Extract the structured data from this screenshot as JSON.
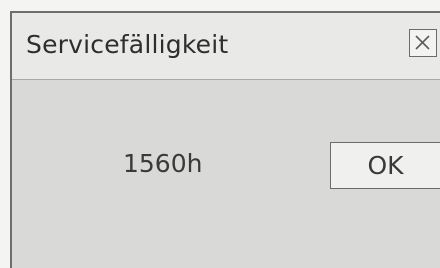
{
  "dialog": {
    "title": "Servicefälligkeit",
    "close_icon": "close-icon",
    "value": "1560h",
    "ok_label": "OK"
  },
  "colors": {
    "background": "#f4f4f2",
    "dialog_body": "#d9d9d7",
    "titlebar": "#e9e9e7",
    "border": "#6e6e6c",
    "text": "#2e2e2e"
  }
}
